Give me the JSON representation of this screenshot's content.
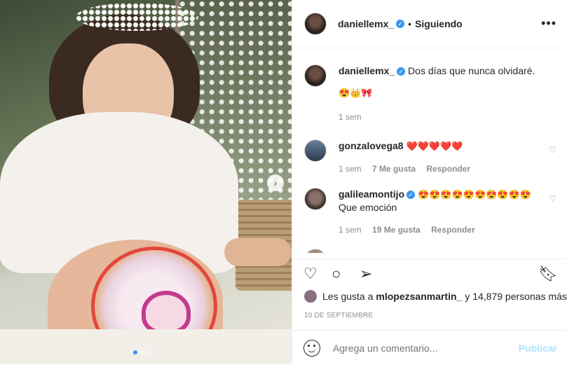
{
  "post": {
    "author": "daniellemx_",
    "follow_status": "Siguiendo",
    "separator": "•",
    "more_icon": "more-horizontal-icon"
  },
  "caption": {
    "username": "daniellemx_",
    "text": "Dos días que nunca olvidaré.",
    "emojis": "😍👑🎀",
    "time": "1 sem"
  },
  "comments": [
    {
      "username": "gonzalovega8",
      "verified": false,
      "text": "❤️❤️❤️❤️❤️",
      "time": "1 sem",
      "likes": "7 Me gusta",
      "reply": "Responder"
    },
    {
      "username": "galileamontijo",
      "verified": true,
      "text": "😍😍😍😍😍😍😍😍😍😍",
      "text2": "Que emoción",
      "time": "1 sem",
      "likes": "19 Me gusta",
      "reply": "Responder"
    }
  ],
  "likes": {
    "prefix": "Les gusta a",
    "user": "mlopezsanmartin_",
    "suffix": "y 14,879 personas más"
  },
  "date": "10 DE SEPTIEMBRE",
  "composer": {
    "placeholder": "Agrega un comentario...",
    "publish": "Publicar"
  },
  "carousel": {
    "total": 3,
    "active": 1
  }
}
